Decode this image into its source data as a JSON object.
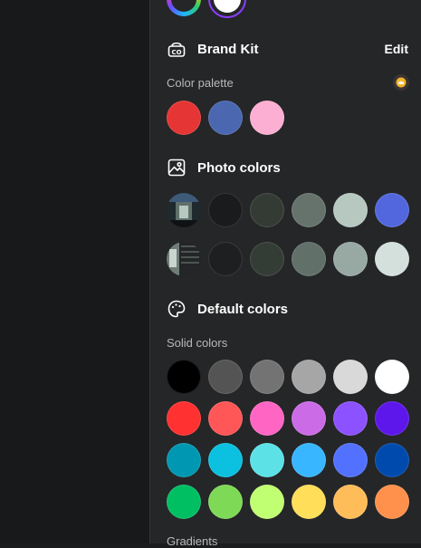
{
  "brand_kit": {
    "title": "Brand Kit",
    "edit_label": "Edit",
    "palette_label": "Color palette",
    "icon": "brand-kit-icon",
    "palette": [
      "#e53535",
      "#4a67b0",
      "#fcafd3"
    ]
  },
  "photo_colors": {
    "title": "Photo colors",
    "icon": "image-icon",
    "rows": [
      {
        "swatches": [
          "#1a1b1c",
          "#333b34",
          "#66736d",
          "#b7c8c0",
          "#5267dd"
        ]
      },
      {
        "swatches": [
          "#1e1f21",
          "#343c36",
          "#617069",
          "#98a8a2",
          "#d4e0db"
        ]
      }
    ]
  },
  "default_colors": {
    "title": "Default colors",
    "icon": "palette-icon",
    "solid_label": "Solid colors",
    "rows": [
      [
        "#000000",
        "#545454",
        "#737373",
        "#a6a6a6",
        "#d9d9d9",
        "#ffffff"
      ],
      [
        "#ff3131",
        "#ff5757",
        "#ff66c4",
        "#cb6ce6",
        "#8c52ff",
        "#5e17eb"
      ],
      [
        "#0097b2",
        "#0cc0df",
        "#5ce1e6",
        "#38b6ff",
        "#5271ff",
        "#004aad"
      ],
      [
        "#00bf63",
        "#7ed957",
        "#c1ff72",
        "#ffde59",
        "#ffbd59",
        "#ff914d"
      ]
    ],
    "gradients_label": "Gradients"
  }
}
